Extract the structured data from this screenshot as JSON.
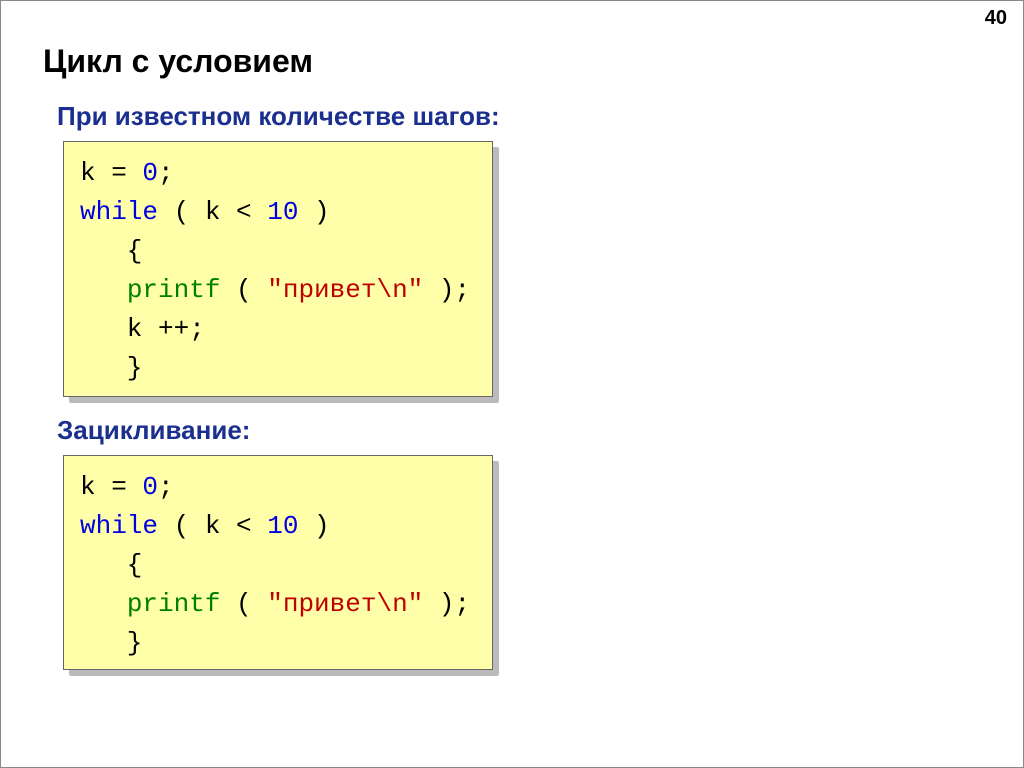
{
  "pageNumber": "40",
  "title": "Цикл с условием",
  "sub1": "При известном количестве шагов:",
  "sub2": "Зацикливание:",
  "code1": {
    "l1a": "k = ",
    "l1b": "0",
    "l1c": ";",
    "l2a": "while",
    "l2b": " ( k < ",
    "l2c": "10",
    "l2d": " )",
    "l3": "   {",
    "l4a": "   ",
    "l4b": "printf",
    "l4c": " ( ",
    "l4d": "\"привет\\n\"",
    "l4e": " );",
    "l5": "   k ++;",
    "l6": "   }"
  },
  "code2": {
    "l1a": "k = ",
    "l1b": "0",
    "l1c": ";",
    "l2a": "while",
    "l2b": " ( k < ",
    "l2c": "10",
    "l2d": " )",
    "l3": "   {",
    "l4a": "   ",
    "l4b": "printf",
    "l4c": " ( ",
    "l4d": "\"привет\\n\"",
    "l4e": " );",
    "l5": "   }"
  }
}
